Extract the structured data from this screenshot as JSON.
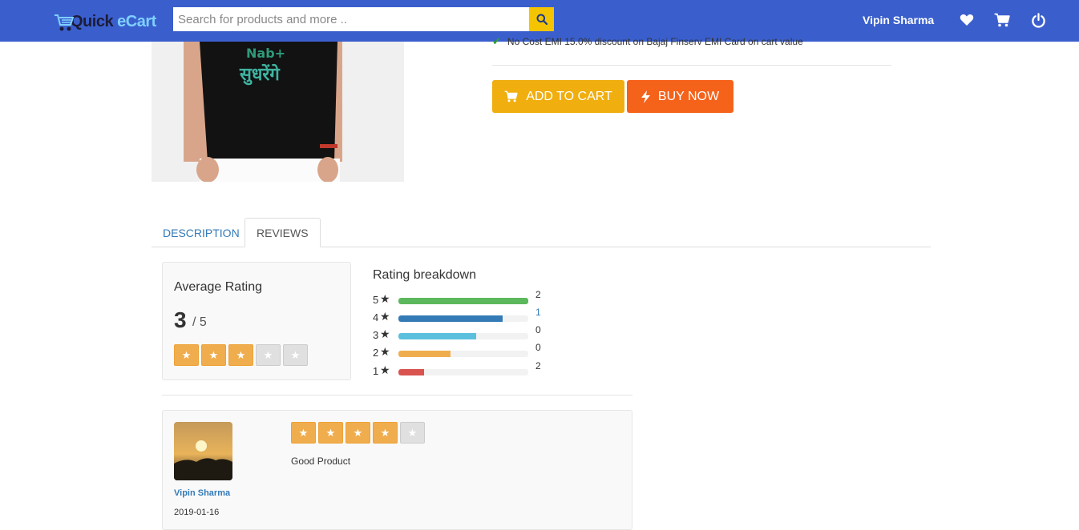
{
  "header": {
    "logo_text_a": "Quick",
    "logo_text_b": "eCart",
    "search_placeholder": "Search for products and more ..",
    "user_name": "Vipin Sharma",
    "icons": [
      "heart-icon",
      "cart-icon",
      "power-icon"
    ],
    "bar_color": "#3a5fcd",
    "search_button_color": "#f5c400"
  },
  "product": {
    "offer_text": "No Cost EMI 15.0% discount on Bajaj Finserv EMI Card on cart value",
    "add_to_cart_label": "ADD TO CART",
    "buy_now_label": "BUY NOW",
    "add_to_cart_color": "#f0ae0f",
    "buy_now_color": "#f5621a"
  },
  "tabs": [
    {
      "label": "DESCRIPTION",
      "active": false
    },
    {
      "label": "REVIEWS",
      "active": true
    }
  ],
  "rating": {
    "title": "Average Rating",
    "value": "3",
    "out_of": "/ 5",
    "stars_on": 3,
    "stars_total": 5
  },
  "breakdown": {
    "title": "Rating breakdown",
    "rows": [
      {
        "label": "5",
        "count": "2",
        "fill": 1.0,
        "color": "#5cb85c"
      },
      {
        "label": "4",
        "count": "1",
        "fill": 0.8,
        "color": "#337ab7"
      },
      {
        "label": "3",
        "count": "0",
        "fill": 0.6,
        "color": "#5bc0de"
      },
      {
        "label": "2",
        "count": "0",
        "fill": 0.4,
        "color": "#f0ad4e"
      },
      {
        "label": "1",
        "count": "2",
        "fill": 0.2,
        "color": "#d9534f"
      }
    ]
  },
  "review": {
    "name": "Vipin Sharma",
    "date": "2019-01-16",
    "text": "Good Product",
    "stars_on": 4,
    "stars_total": 5
  }
}
